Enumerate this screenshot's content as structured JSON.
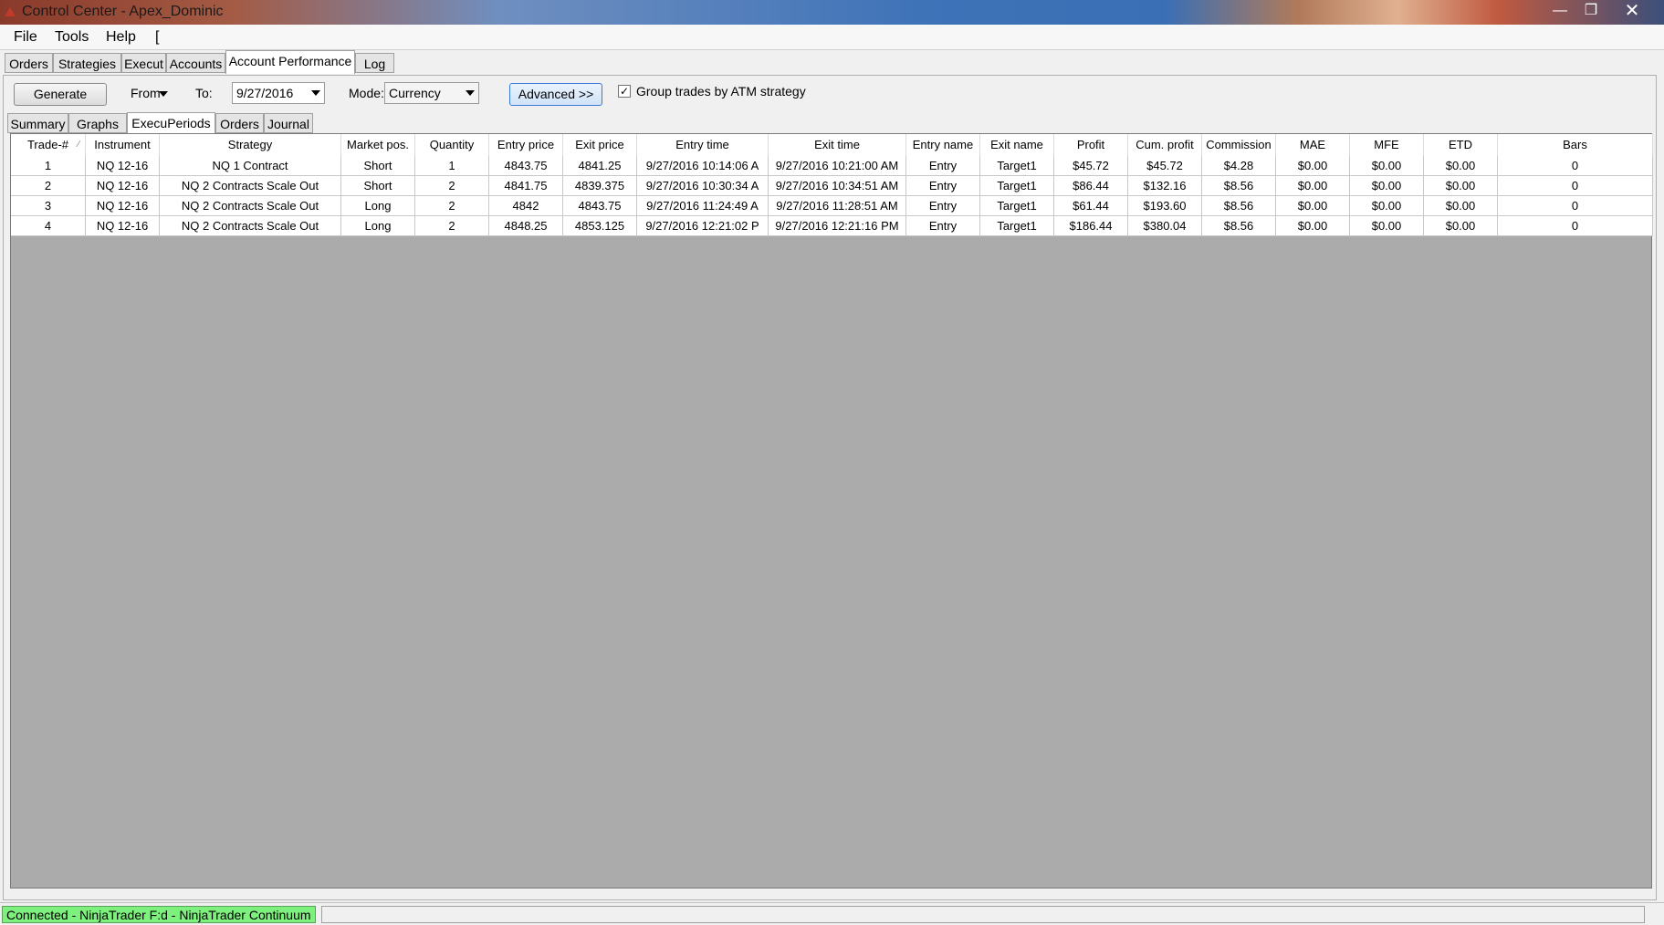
{
  "window": {
    "title": "Control Center - Apex_Dominic",
    "minimize": "—",
    "maximize": "❐",
    "close": "✕"
  },
  "menu": [
    "File",
    "Tools",
    "Help",
    "["
  ],
  "top_tabs": [
    "Orders",
    "Strategies",
    "Execut",
    "Accounts",
    "Account Performance",
    "Log"
  ],
  "active_top_tab": "Account Performance",
  "controls": {
    "generate": "Generate",
    "from_label": "From",
    "to_label": "To:",
    "to_value": "9/27/2016",
    "mode_label": "Mode:",
    "mode_value": "Currency",
    "advanced": "Advanced >>",
    "group_checked": "✓",
    "group_label": "Group trades by ATM strategy"
  },
  "sub_tabs": [
    "Summary",
    "Graphs",
    "ExecuPeriods",
    "Orders",
    "Journal"
  ],
  "columns": [
    "Trade-#",
    "Instrument",
    "Strategy",
    "Market pos.",
    "Quantity",
    "Entry price",
    "Exit price",
    "Entry time",
    "Exit time",
    "Entry name",
    "Exit name",
    "Profit",
    "Cum. profit",
    "Commission",
    "MAE",
    "MFE",
    "ETD",
    "Bars"
  ],
  "rows": [
    [
      "1",
      "NQ 12-16",
      "NQ 1 Contract",
      "Short",
      "1",
      "4843.75",
      "4841.25",
      "9/27/2016 10:14:06 A",
      "9/27/2016 10:21:00 AM",
      "Entry",
      "Target1",
      "$45.72",
      "$45.72",
      "$4.28",
      "$0.00",
      "$0.00",
      "$0.00",
      "0"
    ],
    [
      "2",
      "NQ 12-16",
      "NQ 2 Contracts Scale Out",
      "Short",
      "2",
      "4841.75",
      "4839.375",
      "9/27/2016 10:30:34 A",
      "9/27/2016 10:34:51 AM",
      "Entry",
      "Target1",
      "$86.44",
      "$132.16",
      "$8.56",
      "$0.00",
      "$0.00",
      "$0.00",
      "0"
    ],
    [
      "3",
      "NQ 12-16",
      "NQ 2 Contracts Scale Out",
      "Long",
      "2",
      "4842",
      "4843.75",
      "9/27/2016 11:24:49 A",
      "9/27/2016 11:28:51 AM",
      "Entry",
      "Target1",
      "$61.44",
      "$193.60",
      "$8.56",
      "$0.00",
      "$0.00",
      "$0.00",
      "0"
    ],
    [
      "4",
      "NQ 12-16",
      "NQ 2 Contracts Scale Out",
      "Long",
      "2",
      "4848.25",
      "4853.125",
      "9/27/2016 12:21:02 P",
      "9/27/2016 12:21:16 PM",
      "Entry",
      "Target1",
      "$186.44",
      "$380.04",
      "$8.56",
      "$0.00",
      "$0.00",
      "$0.00",
      "0"
    ]
  ],
  "status": {
    "connection": "Connected - NinjaTrader F:d - NinjaTrader Continuum"
  }
}
